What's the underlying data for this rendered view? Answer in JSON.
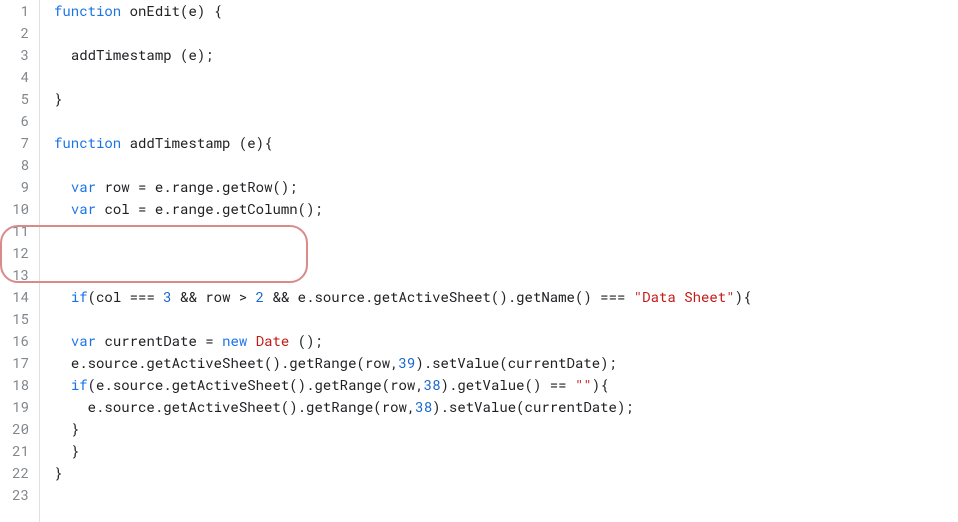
{
  "editor": {
    "lineCount": 23,
    "syntax": {
      "keyword_function": "function",
      "keyword_var": "var",
      "keyword_if": "if",
      "keyword_new": "new",
      "type_Date": "Date"
    },
    "lines": [
      {
        "num": 1,
        "indent": 0,
        "tokens": [
          {
            "t": "keyword",
            "v": "function"
          },
          {
            "t": "space",
            "v": " "
          },
          {
            "t": "default",
            "v": "onEdit"
          },
          {
            "t": "paren",
            "v": "("
          },
          {
            "t": "default",
            "v": "e"
          },
          {
            "t": "paren",
            "v": ")"
          },
          {
            "t": "space",
            "v": " "
          },
          {
            "t": "paren",
            "v": "{"
          }
        ]
      },
      {
        "num": 2,
        "indent": 0,
        "tokens": []
      },
      {
        "num": 3,
        "indent": 1,
        "tokens": [
          {
            "t": "default",
            "v": "addTimestamp "
          },
          {
            "t": "paren",
            "v": "("
          },
          {
            "t": "default",
            "v": "e"
          },
          {
            "t": "paren",
            "v": ")"
          },
          {
            "t": "punc",
            "v": ";"
          }
        ]
      },
      {
        "num": 4,
        "indent": 0,
        "tokens": []
      },
      {
        "num": 5,
        "indent": 0,
        "tokens": [
          {
            "t": "paren",
            "v": "}"
          }
        ]
      },
      {
        "num": 6,
        "indent": 0,
        "tokens": []
      },
      {
        "num": 7,
        "indent": 0,
        "tokens": [
          {
            "t": "keyword",
            "v": "function"
          },
          {
            "t": "space",
            "v": " "
          },
          {
            "t": "default",
            "v": "addTimestamp "
          },
          {
            "t": "paren",
            "v": "("
          },
          {
            "t": "default",
            "v": "e"
          },
          {
            "t": "paren",
            "v": ")"
          },
          {
            "t": "paren",
            "v": "{"
          }
        ]
      },
      {
        "num": 8,
        "indent": 0,
        "tokens": []
      },
      {
        "num": 9,
        "indent": 1,
        "tokens": [
          {
            "t": "var",
            "v": "var"
          },
          {
            "t": "space",
            "v": " "
          },
          {
            "t": "default",
            "v": "row = e.range.getRow"
          },
          {
            "t": "paren",
            "v": "("
          },
          {
            "t": "paren",
            "v": ")"
          },
          {
            "t": "punc",
            "v": ";"
          }
        ]
      },
      {
        "num": 10,
        "indent": 1,
        "tokens": [
          {
            "t": "var",
            "v": "var"
          },
          {
            "t": "space",
            "v": " "
          },
          {
            "t": "default",
            "v": "col = e.range.getColumn"
          },
          {
            "t": "paren",
            "v": "("
          },
          {
            "t": "paren",
            "v": ")"
          },
          {
            "t": "punc",
            "v": ";"
          }
        ]
      },
      {
        "num": 11,
        "indent": 0,
        "tokens": []
      },
      {
        "num": 12,
        "indent": 0,
        "tokens": []
      },
      {
        "num": 13,
        "indent": 0,
        "tokens": []
      },
      {
        "num": 14,
        "indent": 1,
        "tokens": [
          {
            "t": "keyword",
            "v": "if"
          },
          {
            "t": "paren",
            "v": "("
          },
          {
            "t": "default",
            "v": "col === "
          },
          {
            "t": "number",
            "v": "3"
          },
          {
            "t": "default",
            "v": " && row > "
          },
          {
            "t": "number",
            "v": "2"
          },
          {
            "t": "default",
            "v": " && e.source.getActiveSheet"
          },
          {
            "t": "paren",
            "v": "("
          },
          {
            "t": "paren",
            "v": ")"
          },
          {
            "t": "default",
            "v": ".getName"
          },
          {
            "t": "paren",
            "v": "("
          },
          {
            "t": "paren",
            "v": ")"
          },
          {
            "t": "default",
            "v": " === "
          },
          {
            "t": "string",
            "v": "\"Data Sheet\""
          },
          {
            "t": "paren",
            "v": ")"
          },
          {
            "t": "paren",
            "v": "{"
          }
        ]
      },
      {
        "num": 15,
        "indent": 0,
        "tokens": []
      },
      {
        "num": 16,
        "indent": 1,
        "tokens": [
          {
            "t": "var",
            "v": "var"
          },
          {
            "t": "space",
            "v": " "
          },
          {
            "t": "default",
            "v": "currentDate = "
          },
          {
            "t": "new",
            "v": "new"
          },
          {
            "t": "space",
            "v": " "
          },
          {
            "t": "type",
            "v": "Date"
          },
          {
            "t": "space",
            "v": " "
          },
          {
            "t": "paren",
            "v": "("
          },
          {
            "t": "paren",
            "v": ")"
          },
          {
            "t": "punc",
            "v": ";"
          }
        ]
      },
      {
        "num": 17,
        "indent": 1,
        "tokens": [
          {
            "t": "default",
            "v": "e.source.getActiveSheet"
          },
          {
            "t": "paren",
            "v": "("
          },
          {
            "t": "paren",
            "v": ")"
          },
          {
            "t": "default",
            "v": ".getRange"
          },
          {
            "t": "paren",
            "v": "("
          },
          {
            "t": "default",
            "v": "row,"
          },
          {
            "t": "number",
            "v": "39"
          },
          {
            "t": "paren",
            "v": ")"
          },
          {
            "t": "default",
            "v": ".setValue"
          },
          {
            "t": "paren",
            "v": "("
          },
          {
            "t": "default",
            "v": "currentDate"
          },
          {
            "t": "paren",
            "v": ")"
          },
          {
            "t": "punc",
            "v": ";"
          }
        ]
      },
      {
        "num": 18,
        "indent": 1,
        "tokens": [
          {
            "t": "keyword",
            "v": "if"
          },
          {
            "t": "paren",
            "v": "("
          },
          {
            "t": "default",
            "v": "e.source.getActiveSheet"
          },
          {
            "t": "paren",
            "v": "("
          },
          {
            "t": "paren",
            "v": ")"
          },
          {
            "t": "default",
            "v": ".getRange"
          },
          {
            "t": "paren",
            "v": "("
          },
          {
            "t": "default",
            "v": "row,"
          },
          {
            "t": "number",
            "v": "38"
          },
          {
            "t": "paren",
            "v": ")"
          },
          {
            "t": "default",
            "v": ".getValue"
          },
          {
            "t": "paren",
            "v": "("
          },
          {
            "t": "paren",
            "v": ")"
          },
          {
            "t": "default",
            "v": " == "
          },
          {
            "t": "string",
            "v": "\"\""
          },
          {
            "t": "paren",
            "v": ")"
          },
          {
            "t": "paren",
            "v": "{"
          }
        ]
      },
      {
        "num": 19,
        "indent": 2,
        "tokens": [
          {
            "t": "default",
            "v": "e.source.getActiveSheet"
          },
          {
            "t": "paren",
            "v": "("
          },
          {
            "t": "paren",
            "v": ")"
          },
          {
            "t": "default",
            "v": ".getRange"
          },
          {
            "t": "paren",
            "v": "("
          },
          {
            "t": "default",
            "v": "row,"
          },
          {
            "t": "number",
            "v": "38"
          },
          {
            "t": "paren",
            "v": ")"
          },
          {
            "t": "default",
            "v": ".setValue"
          },
          {
            "t": "paren",
            "v": "("
          },
          {
            "t": "default",
            "v": "currentDate"
          },
          {
            "t": "paren",
            "v": ")"
          },
          {
            "t": "punc",
            "v": ";"
          }
        ]
      },
      {
        "num": 20,
        "indent": 1,
        "tokens": [
          {
            "t": "paren",
            "v": "}"
          }
        ]
      },
      {
        "num": 21,
        "indent": 1,
        "tokens": [
          {
            "t": "paren",
            "v": "}"
          }
        ]
      },
      {
        "num": 22,
        "indent": 0,
        "tokens": [
          {
            "t": "paren",
            "v": "}"
          }
        ]
      },
      {
        "num": 23,
        "indent": 0,
        "tokens": []
      }
    ]
  }
}
